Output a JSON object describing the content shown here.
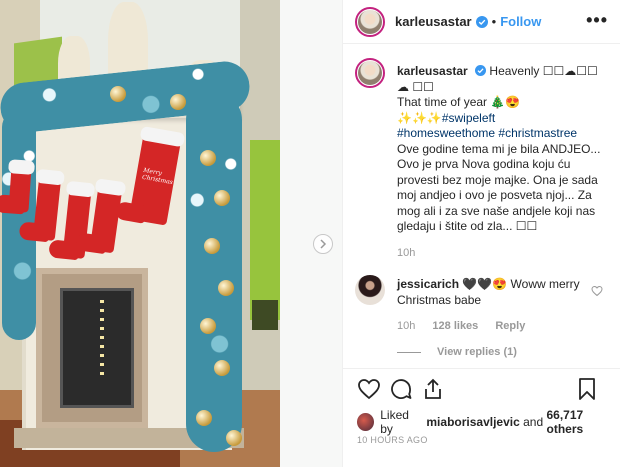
{
  "post": {
    "username": "karleusastar",
    "follow_label": "Follow",
    "more_label": "•••",
    "caption_lines": [
      "Heavenly ☐☐☁☐☐☁ ☐☐",
      "That time of year 🎄😍",
      "✨✨✨#swipeleft",
      "#homesweethome #christmastree",
      "Ove godine tema mi je bila ANDJEO... Ovo je prva Nova godina koju ću provesti bez moje majke. Ona je sada moj andjeo i ovo je posveta njoj... Za mog ali i za sve naše andjele koji nas gledaju i štite od zla... ☐☐"
    ],
    "caption_time": "10h",
    "likes_user": "miaborisavljevic",
    "likes_others": "66,717 others",
    "likes_prefix": "Liked by",
    "likes_and": "and",
    "posted_ago": "10 HOURS AGO"
  },
  "comment": {
    "username": "jessicarich",
    "text": "🖤🖤😍 Woww merry Christmas babe",
    "time": "10h",
    "likes": "128 likes",
    "reply_label": "Reply",
    "view_replies": "View replies (1)"
  },
  "stocking_label": "Merry Christmas",
  "icons": {
    "verified": "verified-badge-icon",
    "heart": "heart-icon",
    "comment": "comment-icon",
    "share": "share-icon",
    "bookmark": "bookmark-icon",
    "next": "chevron-right-icon"
  },
  "colors": {
    "link_blue": "#3897f0",
    "hashtag": "#003569",
    "muted": "#999999"
  }
}
